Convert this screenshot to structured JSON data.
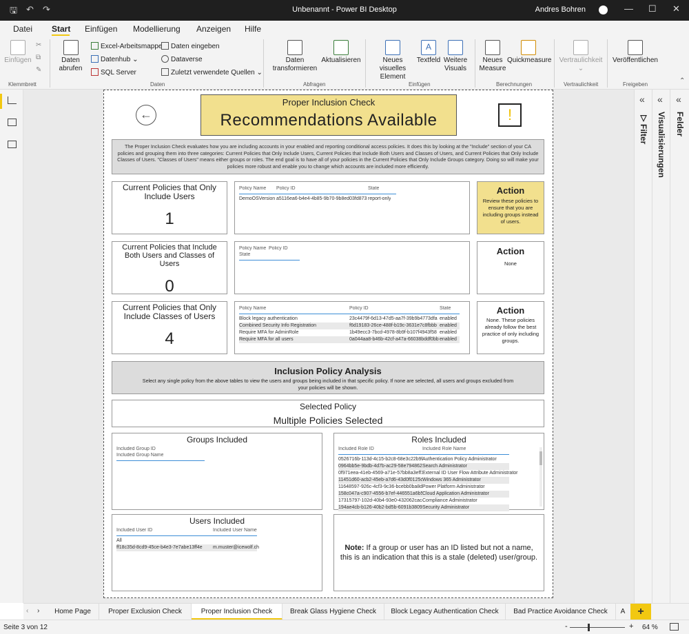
{
  "window": {
    "title": "Unbenannt - Power BI Desktop",
    "user": "Andres Bohren"
  },
  "menu": [
    "Datei",
    "Start",
    "Einfügen",
    "Modellierung",
    "Anzeigen",
    "Hilfe"
  ],
  "ribbon": {
    "paste": "Einfügen",
    "clipboard_group": "Klemmbrett",
    "get_data": "Daten\nabrufen",
    "excel": "Excel-Arbeitsmappe",
    "datahub": "Datenhub",
    "sqlserver": "SQL Server",
    "enter_data": "Daten eingeben",
    "dataverse": "Dataverse",
    "recent": "Zuletzt verwendete Quellen",
    "data_group": "Daten",
    "transform": "Daten\ntransformieren",
    "refresh": "Aktualisieren",
    "queries_group": "Abfragen",
    "new_visual": "Neues visuelles\nElement",
    "textbox": "Textfeld",
    "more_visuals": "Weitere\nVisuals",
    "insert_group": "Einfügen",
    "new_measure": "Neues\nMeasure",
    "quick_measure": "Quickmeasure",
    "calc_group": "Berechnungen",
    "sensitivity": "Vertraulichkeit",
    "sens_group": "Vertraulichkeit",
    "publish": "Veröffentlichen",
    "share_group": "Freigeben"
  },
  "panes": {
    "filter": "Filter",
    "visualizations": "Visualisierungen",
    "fields": "Felder"
  },
  "report": {
    "header_small": "Proper Inclusion Check",
    "header_big": "Recommendations Available",
    "warning": "!",
    "description": "The Proper Inclusion Check evaluates how you are including accounts in your enabled and reporting conditional access policies. It does this by looking at the \"Include\" section of your CA policies and grouping them into three categories: Current Policies that Only Include Users, Current Policies that Include Both Users and Classes of Users, and Current Policies that Only Include Classes of Users. \"Classes of Users\" means either groups or roles. The end goal is to have all of your policies in the Current Policies that Only Include Groups category. Doing so will make your policies more robust and enable you to change which accounts are included more efficiently.",
    "cards": [
      {
        "title": "Current Policies that Only Include Users",
        "value": "1"
      },
      {
        "title": "Current Policies that Include Both Users and Classes of Users",
        "value": "0"
      },
      {
        "title": "Current Policies that Only Include Classes of Users",
        "value": "4"
      }
    ],
    "table_headers": {
      "name": "Policy Name",
      "id": "Policy ID",
      "state": "State"
    },
    "table1": [
      [
        "DemoOSVersion",
        "a5116ea6-b4e4-4b85-9b70-9b8ed03fd873",
        "report-only"
      ]
    ],
    "table3": [
      [
        "Block legacy authentication",
        "23c4479f-6d13-47d5-aa7f-39b9b4773dfa",
        "enabled"
      ],
      [
        "Combined Security Info Registration",
        "f6d19183-26ce-488f-b19c-3631e7c8fbbb",
        "enabled"
      ],
      [
        "Require MFA for AdminRole",
        "1b49ecc3-7bcd-4978-8b9f-b107f4943f58",
        "enabled"
      ],
      [
        "Require MFA for all users",
        "0a044aa8-b46b-42cf-a47a-66038bddf0bb",
        "enabled"
      ]
    ],
    "actions": [
      {
        "title": "Action",
        "text": "Review these policies to ensure that you are including groups instead of users."
      },
      {
        "title": "Action",
        "text": "None"
      },
      {
        "title": "Action",
        "text": "None. These policies already follow the best practice of only including groups."
      }
    ],
    "analysis_title": "Inclusion Policy Analysis",
    "analysis_text": "Select any single policy from the above tables to view the users and groups being included in that specific policy. If none are selected, all users and groups excluded from your policies will be shown.",
    "selected_label": "Selected Policy",
    "selected_value": "Multiple Policies Selected",
    "groups_title": "Groups Included",
    "groups_headers": [
      "Included Group ID",
      "Included Group Name"
    ],
    "roles_title": "Roles Included",
    "roles_headers": [
      "Included Role ID",
      "Included Role Name"
    ],
    "roles": [
      [
        "0526716b-113d-4c15-b2c8-68e3c22b9f80",
        "Authentication Policy Administrator"
      ],
      [
        "0964bb5e-9bdb-4d7b-ac29-58e794862a40",
        "Search Administrator"
      ],
      [
        "0f971eea-41eb-4569-a71e-57bb8a3eff1e",
        "External ID User Flow Attribute Administrator"
      ],
      [
        "11451d60-acb2-45eb-a7d6-43d0f0125c13",
        "Windows 365 Administrator"
      ],
      [
        "11648597-926c-4cf3-9c36-bcebb0ba8dcc",
        "Power Platform Administrator"
      ],
      [
        "158c047a-c907-4556-b7ef-446551a6b5f7",
        "Cloud Application Administrator"
      ],
      [
        "17315797-102d-40b4-93e0-432062caca18",
        "Compliance Administrator"
      ],
      [
        "194ae4cb-b126-40b2-bd5b-6091b380977d",
        "Security Administrator"
      ]
    ],
    "users_title": "Users Included",
    "users_headers": [
      "Included User ID",
      "Included User Name"
    ],
    "users": [
      [
        "All",
        ""
      ],
      [
        "ff18c35d-8cd9-45ce-b4e3-7e7abe13ff4e",
        "m.muster@icewolf.ch"
      ]
    ],
    "note_bold": "Note:",
    "note_text": "If a group or user has an ID listed but not a name, this is an indication that this is a stale (deleted) user/group."
  },
  "tabs": [
    "Home Page",
    "Proper Exclusion Check",
    "Proper Inclusion Check",
    "Break Glass Hygiene Check",
    "Block Legacy Authentication Check",
    "Bad Practice Avoidance Check",
    "A"
  ],
  "active_tab": "Proper Inclusion Check",
  "status": {
    "page": "Seite 3 von 12",
    "zoom": "64 %"
  }
}
